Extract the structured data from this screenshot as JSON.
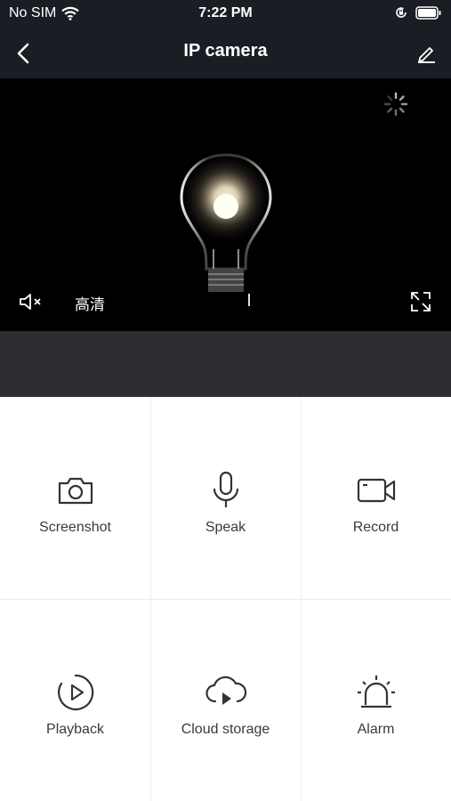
{
  "status_bar": {
    "carrier": "No SIM",
    "time": "7:22 PM",
    "icons": [
      "wifi-icon",
      "orientation-lock-icon",
      "battery-icon"
    ]
  },
  "nav": {
    "title": "IP camera",
    "back_icon": "chevron-left-icon",
    "edit_icon": "pencil-icon"
  },
  "video": {
    "quality_label": "高清",
    "mute_icon": "speaker-muted-icon",
    "fullscreen_icon": "fullscreen-icon",
    "loading_icon": "spinner-icon"
  },
  "actions": [
    {
      "label": "Screenshot",
      "icon": "camera-icon"
    },
    {
      "label": "Speak",
      "icon": "microphone-icon"
    },
    {
      "label": "Record",
      "icon": "video-camera-icon"
    },
    {
      "label": "Playback",
      "icon": "playback-icon"
    },
    {
      "label": "Cloud storage",
      "icon": "cloud-play-icon"
    },
    {
      "label": "Alarm",
      "icon": "alarm-siren-icon"
    }
  ],
  "colors": {
    "header_bg": "#1b1d24",
    "video_bg": "#000000",
    "video_bar_bg": "#2c2e33",
    "icon_color": "#333333",
    "label_color": "#3a3a3a"
  }
}
